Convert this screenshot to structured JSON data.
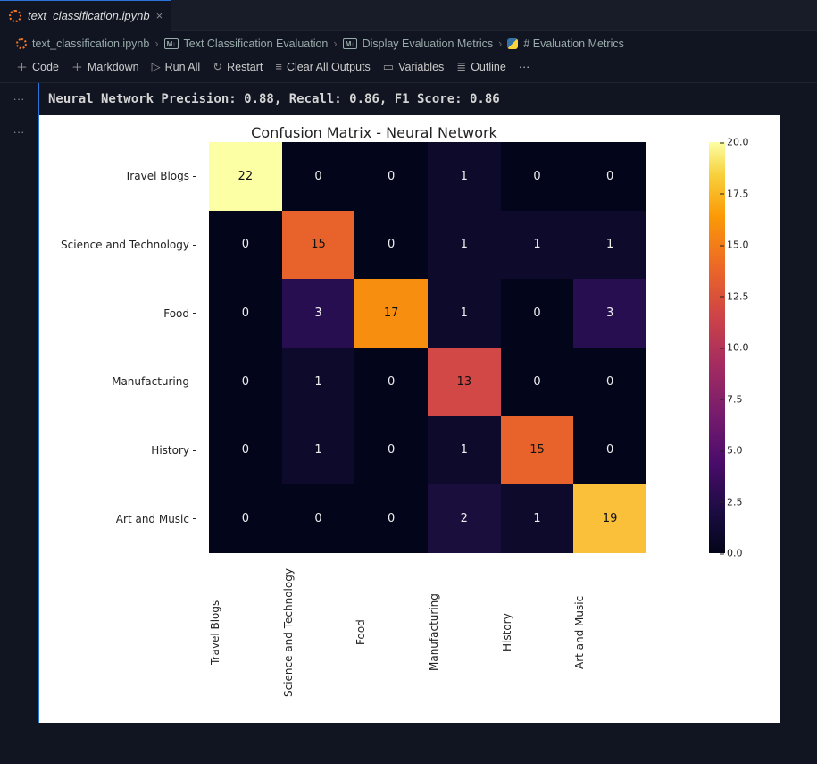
{
  "tab": {
    "title": "text_classification.ipynb",
    "close": "×"
  },
  "breadcrumbs": {
    "file": "text_classification.ipynb",
    "h1": "Text Classification Evaluation",
    "h2": "Display Evaluation Metrics",
    "cell": "# Evaluation Metrics"
  },
  "toolbar": {
    "code": "Code",
    "markdown": "Markdown",
    "runAll": "Run All",
    "restart": "Restart",
    "clear": "Clear All Outputs",
    "variables": "Variables",
    "outline": "Outline",
    "more": "···"
  },
  "gutter": {
    "dots1": "···",
    "dots2": "···"
  },
  "output": {
    "text": "Neural Network Precision: 0.88, Recall: 0.86, F1 Score: 0.86"
  },
  "chart_data": {
    "type": "heatmap",
    "title": "Confusion Matrix - Neural Network",
    "row_labels": [
      "Travel Blogs",
      "Science and Technology",
      "Food",
      "Manufacturing",
      "History",
      "Art and Music"
    ],
    "col_labels": [
      "Travel Blogs",
      "Science and Technology",
      "Food",
      "Manufacturing",
      "History",
      "Art and Music"
    ],
    "values": [
      [
        22,
        0,
        0,
        1,
        0,
        0
      ],
      [
        0,
        15,
        0,
        1,
        1,
        1
      ],
      [
        0,
        3,
        17,
        1,
        0,
        3
      ],
      [
        0,
        1,
        0,
        13,
        0,
        0
      ],
      [
        0,
        1,
        0,
        1,
        15,
        0
      ],
      [
        0,
        0,
        0,
        2,
        1,
        19
      ]
    ],
    "colorbar_ticks": [
      "0.0",
      "2.5",
      "5.0",
      "7.5",
      "10.0",
      "12.5",
      "15.0",
      "17.5",
      "20.0"
    ],
    "cmap_range": [
      0,
      22
    ]
  }
}
